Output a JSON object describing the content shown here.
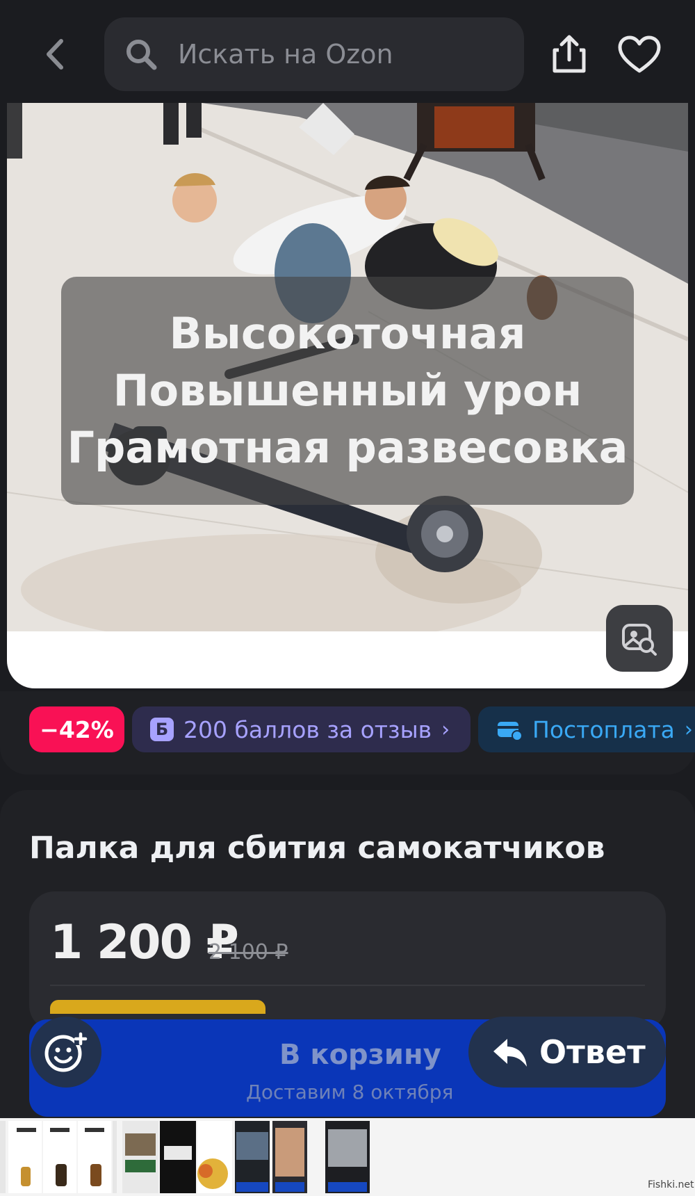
{
  "header": {
    "search_placeholder": "Искать на Ozon"
  },
  "product_image": {
    "caption_lines": [
      "Высокоточная",
      "Повышенный урон",
      "Грамотная развесовка"
    ]
  },
  "badges": {
    "discount": "−42%",
    "points": "200 баллов за отзыв",
    "points_icon_letter": "Б",
    "postpay": "Постоплата"
  },
  "product": {
    "title": "Палка для сбития самокатчиков",
    "price": "1 200 ₽",
    "old_price": "2 100 ₽"
  },
  "cart": {
    "label": "В корзину",
    "delivery": "Доставим 8 октября"
  },
  "overlay": {
    "reply_label": "Ответ"
  },
  "footer": {
    "watermark": "Fishki.net"
  },
  "colors": {
    "background": "#1b1c20",
    "discount_badge": "#f91155",
    "points_text": "#a7a2ff",
    "postpay_text": "#3aa9f5",
    "cart_button": "#0a36b8"
  }
}
